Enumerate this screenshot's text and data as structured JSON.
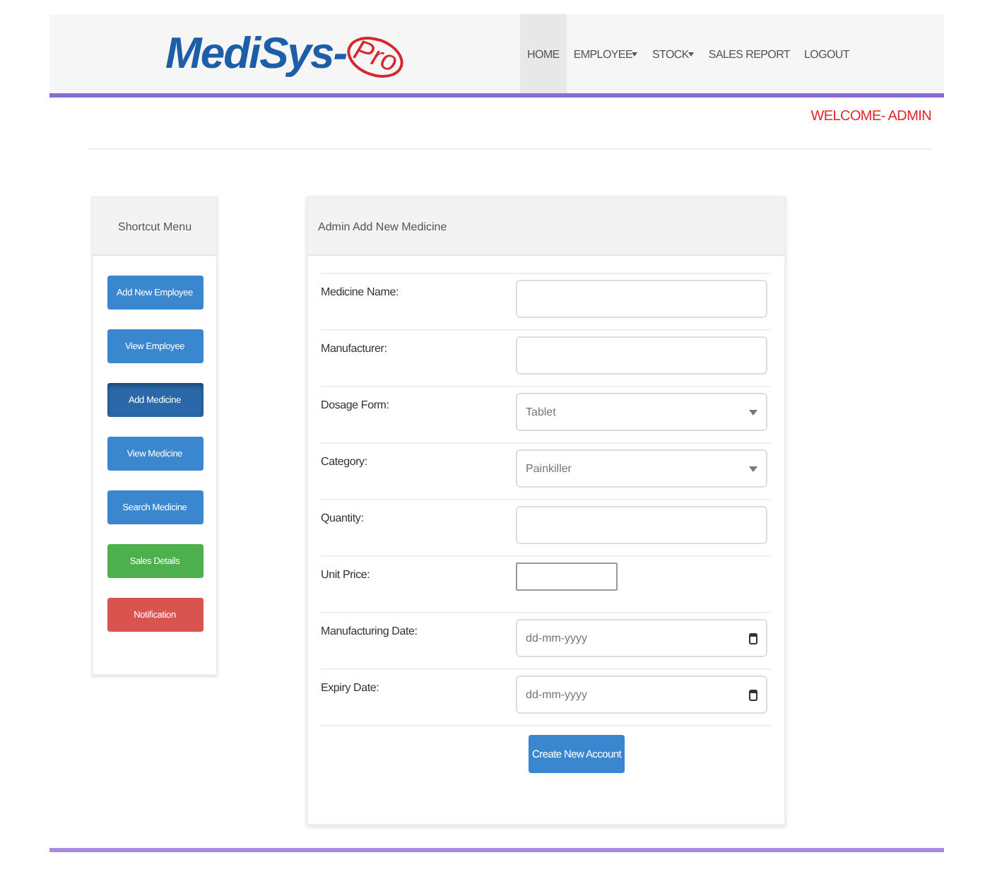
{
  "logo": {
    "main": "MediSys-",
    "accent": "Pro"
  },
  "nav": [
    {
      "label": "HOME",
      "selected": true,
      "dropdown": false
    },
    {
      "label": "EMPLOYEE",
      "selected": false,
      "dropdown": true
    },
    {
      "label": "STOCK",
      "selected": false,
      "dropdown": true
    },
    {
      "label": "SALES REPORT",
      "selected": false,
      "dropdown": false
    },
    {
      "label": "LOGOUT",
      "selected": false,
      "dropdown": false
    }
  ],
  "welcome": "WELCOME- ADMIN",
  "sidebar": {
    "title": "Shortcut Menu",
    "items": [
      {
        "label": "Add New Employee",
        "color": "#3a87d0",
        "selected": false
      },
      {
        "label": "View Employee",
        "color": "#3a87d0",
        "selected": false
      },
      {
        "label": "Add Medicine",
        "color": "#2a68aa",
        "selected": true
      },
      {
        "label": "View Medicine",
        "color": "#3a87d0",
        "selected": false
      },
      {
        "label": "Search Medicine",
        "color": "#3a87d0",
        "selected": false
      },
      {
        "label": "Sales Details",
        "color": "#4cb04f",
        "selected": false
      },
      {
        "label": "Notification",
        "color": "#d9534f",
        "selected": false
      }
    ]
  },
  "form": {
    "title": "Admin Add New Medicine",
    "fields": [
      {
        "label": "Medicine Name:",
        "kind": "text"
      },
      {
        "label": "Manufacturer:",
        "kind": "text"
      },
      {
        "label": "Dosage Form:",
        "kind": "select",
        "value": "Tablet"
      },
      {
        "label": "Category:",
        "kind": "select",
        "value": "Painkiller"
      },
      {
        "label": "Quantity:",
        "kind": "text"
      },
      {
        "label": "Unit Price:",
        "kind": "small"
      },
      {
        "label": "Manufacturing Date:",
        "kind": "date",
        "placeholder": "dd-mm-yyyy"
      },
      {
        "label": "Expiry Date:",
        "kind": "date",
        "placeholder": "dd-mm-yyyy"
      }
    ],
    "submit": "Create New Account"
  }
}
